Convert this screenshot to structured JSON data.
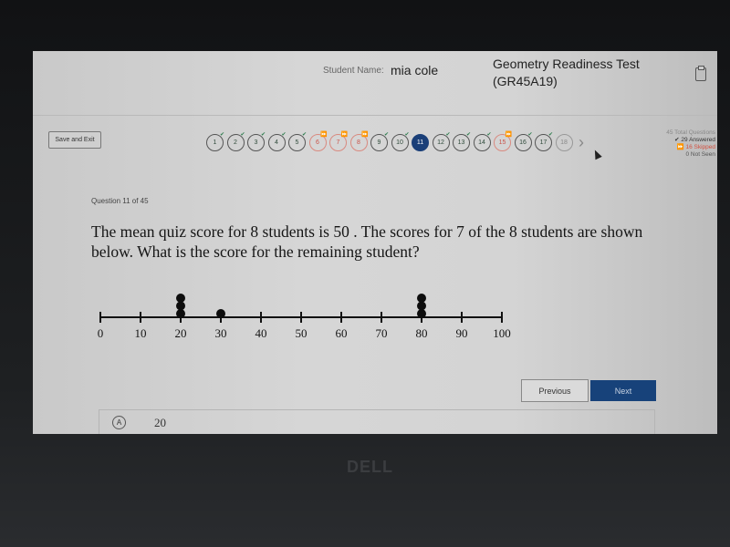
{
  "header": {
    "student_label": "Student Name:",
    "student_name": "mia cole",
    "test_title": "Geometry Readiness Test (GR45A19)",
    "clipboard_icon": "clipboard-icon"
  },
  "toolbar": {
    "save_exit_label": "Save and Exit",
    "questions": [
      {
        "n": "1",
        "status": "answered"
      },
      {
        "n": "2",
        "status": "answered"
      },
      {
        "n": "3",
        "status": "answered"
      },
      {
        "n": "4",
        "status": "answered"
      },
      {
        "n": "5",
        "status": "answered"
      },
      {
        "n": "6",
        "status": "skipped"
      },
      {
        "n": "7",
        "status": "skipped"
      },
      {
        "n": "8",
        "status": "skipped"
      },
      {
        "n": "9",
        "status": "answered"
      },
      {
        "n": "10",
        "status": "answered"
      },
      {
        "n": "11",
        "status": "current"
      },
      {
        "n": "12",
        "status": "answered"
      },
      {
        "n": "13",
        "status": "answered"
      },
      {
        "n": "14",
        "status": "answered"
      },
      {
        "n": "15",
        "status": "skipped"
      },
      {
        "n": "16",
        "status": "answered"
      },
      {
        "n": "17",
        "status": "answered"
      },
      {
        "n": "18",
        "status": "unseen"
      }
    ],
    "next_arrow": "chevron-right-icon",
    "summary": {
      "total": "45 Total Questions",
      "answered": "✔ 29 Answered",
      "skipped": "⏩ 16 Skipped",
      "not_seen": "0 Not Seen"
    }
  },
  "question": {
    "number_label": "Question 11 of 45",
    "text": "The mean quiz score for 8 students is 50 . The scores for 7 of the 8 students are shown below. What is the score for the remaining student?",
    "dot_plot": {
      "tick_labels": [
        "0",
        "10",
        "20",
        "30",
        "40",
        "50",
        "60",
        "70",
        "80",
        "90",
        "100"
      ],
      "range": [
        0,
        100
      ],
      "points": [
        {
          "value": 20,
          "count": 3
        },
        {
          "value": 30,
          "count": 1
        },
        {
          "value": 80,
          "count": 3
        }
      ]
    }
  },
  "buttons": {
    "previous": "Previous",
    "next": "Next"
  },
  "choices": [
    {
      "letter": "A",
      "text": "20"
    }
  ],
  "device": {
    "logo": "DELL"
  }
}
